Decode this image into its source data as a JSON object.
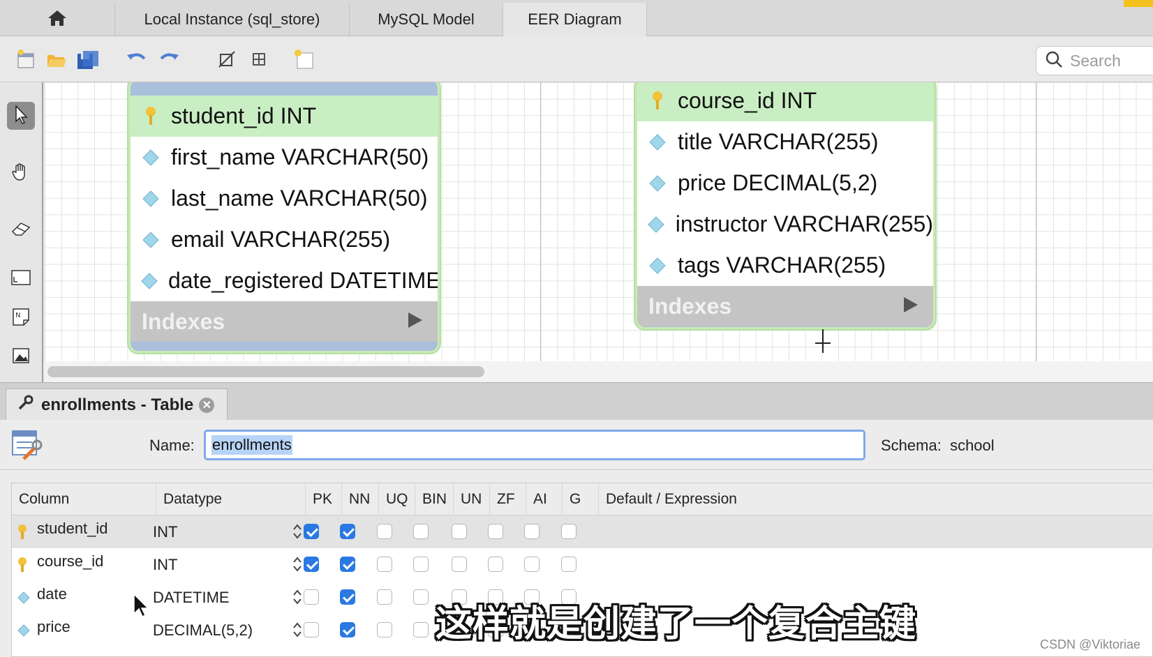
{
  "tabs": {
    "home_icon": "home-icon",
    "items": [
      {
        "label": "Local Instance  (sql_store)"
      },
      {
        "label": "MySQL Model"
      },
      {
        "label": "EER Diagram"
      }
    ],
    "active_index": 2
  },
  "toolbar": {
    "icons": [
      "new-document-icon",
      "open-folder-icon",
      "save-icon",
      "undo-icon",
      "redo-icon",
      "toggle-grid-icon",
      "align-icon",
      "new-diagram-icon"
    ],
    "search_placeholder": "Search"
  },
  "left_tools": {
    "icons": [
      "pointer-icon",
      "hand-icon",
      "eraser-icon",
      "layer-icon",
      "note-icon",
      "image-icon"
    ]
  },
  "diagram": {
    "students_table": {
      "columns": [
        {
          "text": "student_id INT",
          "key": true
        },
        {
          "text": "first_name VARCHAR(50)",
          "key": false
        },
        {
          "text": "last_name VARCHAR(50)",
          "key": false
        },
        {
          "text": "email VARCHAR(255)",
          "key": false
        },
        {
          "text": "date_registered DATETIME",
          "key": false
        }
      ],
      "indexes_label": "Indexes"
    },
    "courses_table": {
      "columns": [
        {
          "text": "course_id INT",
          "key": true
        },
        {
          "text": "title VARCHAR(255)",
          "key": false
        },
        {
          "text": "price DECIMAL(5,2)",
          "key": false
        },
        {
          "text": "instructor VARCHAR(255)",
          "key": false
        },
        {
          "text": "tags VARCHAR(255)",
          "key": false
        }
      ],
      "indexes_label": "Indexes"
    }
  },
  "editor": {
    "tab_title": "enrollments - Table",
    "name_label": "Name:",
    "name_value": "enrollments",
    "schema_label": "Schema:",
    "schema_value": "school",
    "headers": [
      "Column",
      "Datatype",
      "PK",
      "NN",
      "UQ",
      "BIN",
      "UN",
      "ZF",
      "AI",
      "G",
      "Default / Expression"
    ],
    "rows": [
      {
        "column": "student_id",
        "datatype": "INT",
        "pk": true,
        "nn": true,
        "key": true
      },
      {
        "column": "course_id",
        "datatype": "INT",
        "pk": true,
        "nn": true,
        "key": true
      },
      {
        "column": "date",
        "datatype": "DATETIME",
        "pk": false,
        "nn": true,
        "key": false
      },
      {
        "column": "price",
        "datatype": "DECIMAL(5,2)",
        "pk": false,
        "nn": true,
        "key": false
      }
    ]
  },
  "subtitle": "这样就是创建了一个复合主键",
  "watermark": "CSDN @Viktoriae",
  "colors": {
    "pk_row": "#c9eec3",
    "table_header": "#a9bfdb",
    "checkbox_on": "#2a79e3",
    "tab_accent": "#f3c21c"
  }
}
